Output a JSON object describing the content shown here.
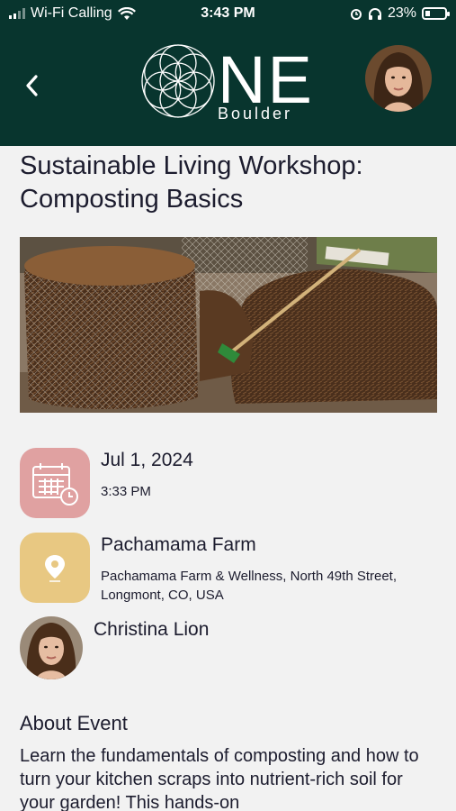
{
  "status_bar": {
    "carrier": "Wi-Fi Calling",
    "time": "3:43 PM",
    "battery": "23%",
    "battery_level": 0.23
  },
  "header": {
    "logo_main": "NE",
    "logo_sub": "Boulder",
    "back_icon": "chevron-left-icon",
    "colors": {
      "background": "#08352e",
      "text": "#ffffff"
    }
  },
  "event": {
    "title": "Sustainable Living Workshop: Composting Basics",
    "date": "Jul 1, 2024",
    "time": "3:33 PM",
    "location_name": "Pachamama Farm",
    "address": "Pachamama Farm & Wellness, North 49th Street, Longmont, CO, USA",
    "host": "Christina Lion",
    "colors": {
      "date_icon_bg": "#e0a1a1",
      "location_icon_bg": "#e8c882"
    }
  },
  "about": {
    "heading": "About Event",
    "text": "Learn the fundamentals of composting and how to turn your kitchen scraps into nutrient-rich soil for your garden! This hands-on"
  }
}
